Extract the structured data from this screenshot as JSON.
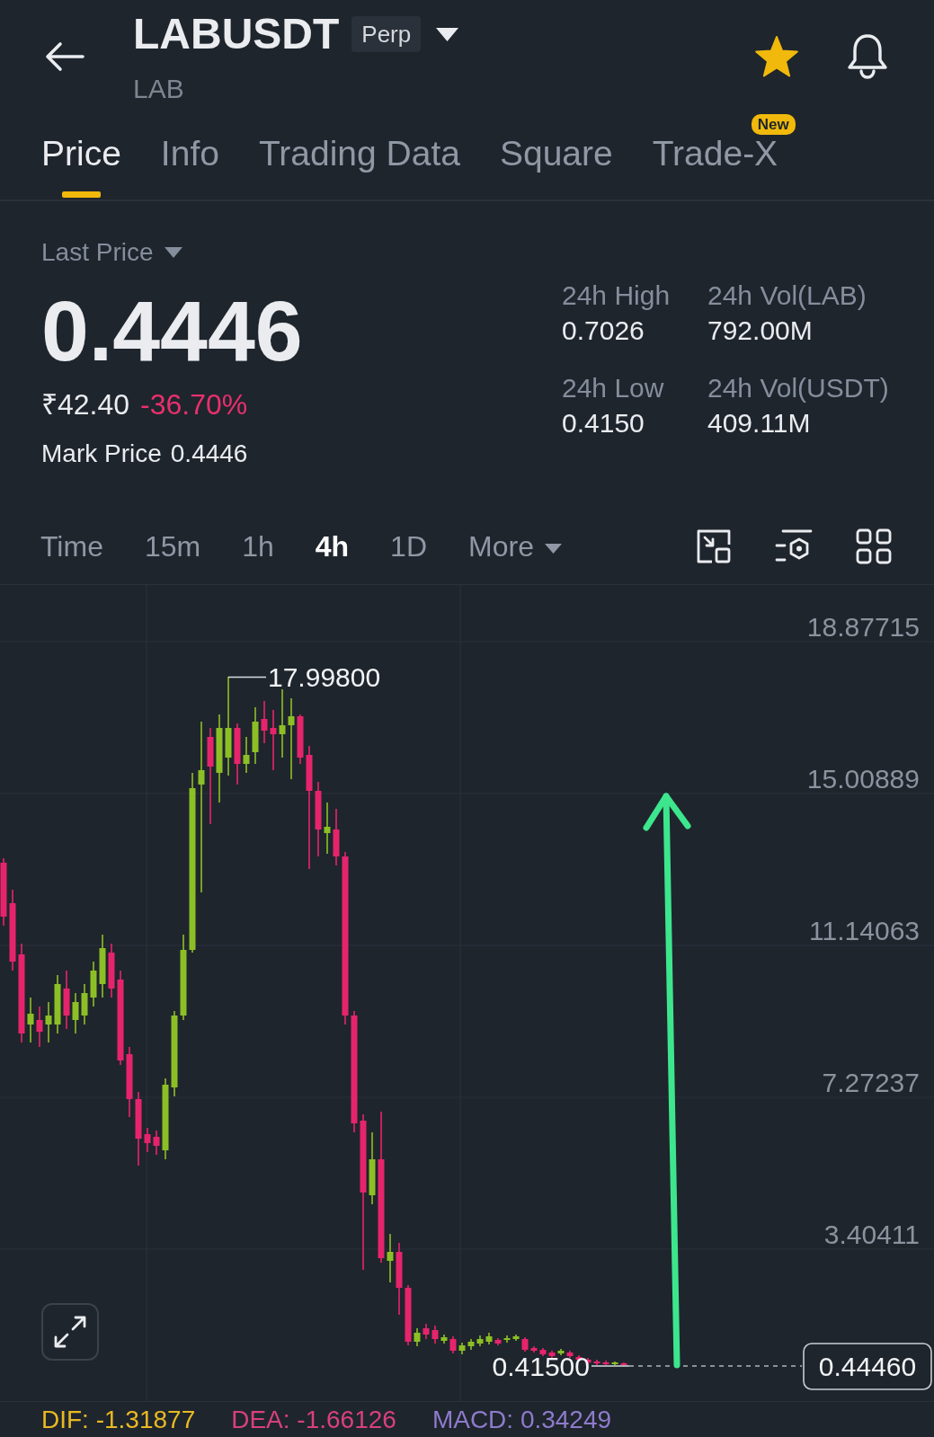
{
  "header": {
    "symbol": "LABUSDT",
    "contract_type": "Perp",
    "base_asset": "LAB",
    "favorited": true
  },
  "tabs": [
    {
      "label": "Price",
      "selected": true
    },
    {
      "label": "Info",
      "selected": false
    },
    {
      "label": "Trading Data",
      "selected": false
    },
    {
      "label": "Square",
      "selected": false
    },
    {
      "label": "Trade-X",
      "selected": false,
      "badge": "New"
    }
  ],
  "price_panel": {
    "price_type": "Last Price",
    "last_price": "0.4446",
    "fiat_price": "₹42.40",
    "change": "-36.70%",
    "rising": false,
    "mark_price_label": "Mark Price",
    "mark_price": "0.4446",
    "stats": [
      {
        "label": "24h High",
        "value": "0.7026"
      },
      {
        "label": "24h Vol(LAB)",
        "value": "792.00M"
      },
      {
        "label": "24h Low",
        "value": "0.4150"
      },
      {
        "label": "24h Vol(USDT)",
        "value": "409.11M"
      }
    ]
  },
  "intervals": [
    {
      "label": "Time",
      "kind": "interval",
      "selected": false
    },
    {
      "label": "15m",
      "kind": "interval",
      "selected": false
    },
    {
      "label": "1h",
      "kind": "interval",
      "selected": false
    },
    {
      "label": "4h",
      "kind": "interval",
      "selected": true
    },
    {
      "label": "1D",
      "kind": "interval",
      "selected": false
    },
    {
      "label": "More",
      "kind": "dropdown",
      "selected": false
    }
  ],
  "chart": {
    "price_ticks": [
      "18.87715",
      "15.00889",
      "11.14063",
      "7.27237",
      "3.40411"
    ],
    "high_marker": "17.99800",
    "low_marker": "0.41500",
    "current_price": "0.44460"
  },
  "indicators": [
    {
      "label": "DIF: -1.31877",
      "color": "#e8b923"
    },
    {
      "label": "DEA: -1.66126",
      "color": "#d8407c"
    },
    {
      "label": "MACD: 0.34249",
      "color": "#8e7bcc"
    }
  ]
}
